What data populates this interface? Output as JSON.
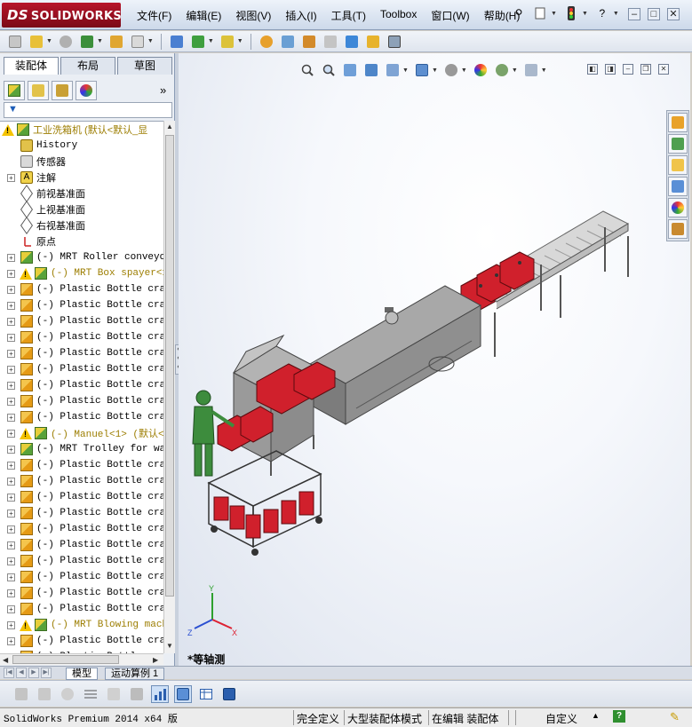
{
  "app": {
    "logo_text": "SOLIDWORKS",
    "logo_prefix": "DS"
  },
  "menu": [
    "文件(F)",
    "编辑(E)",
    "视图(V)",
    "插入(I)",
    "工具(T)",
    "Toolbox",
    "窗口(W)",
    "帮助(H)"
  ],
  "panel_tabs": [
    "装配体",
    "布局",
    "草图"
  ],
  "tree": {
    "root": "工业洗箱机  (默认<默认_显",
    "fixed": [
      "History",
      "传感器",
      "注解",
      "前视基准面",
      "上视基准面",
      "右视基准面",
      "原点"
    ],
    "components": [
      {
        "label": "(-) MRT Roller conveyor",
        "type": "asm",
        "warn": false
      },
      {
        "label": "(-) MRT Box spayer<1",
        "type": "asm",
        "warn": true
      },
      {
        "label": "(-) Plastic Bottle crat",
        "type": "part",
        "warn": false
      },
      {
        "label": "(-) Plastic Bottle crat",
        "type": "part",
        "warn": false
      },
      {
        "label": "(-) Plastic Bottle crat",
        "type": "part",
        "warn": false
      },
      {
        "label": "(-) Plastic Bottle crat",
        "type": "part",
        "warn": false
      },
      {
        "label": "(-) Plastic Bottle crat",
        "type": "part",
        "warn": false
      },
      {
        "label": "(-) Plastic Bottle crat",
        "type": "part",
        "warn": false
      },
      {
        "label": "(-) Plastic Bottle crat",
        "type": "part",
        "warn": false
      },
      {
        "label": "(-) Plastic Bottle crat",
        "type": "part",
        "warn": false
      },
      {
        "label": "(-) Plastic Bottle crat",
        "type": "part",
        "warn": false
      },
      {
        "label": "(-) Manuel<1> (默认<",
        "type": "asm",
        "warn": true
      },
      {
        "label": "(-) MRT Trolley for was",
        "type": "asm",
        "warn": false
      },
      {
        "label": "(-) Plastic Bottle crat",
        "type": "part",
        "warn": false
      },
      {
        "label": "(-) Plastic Bottle crat",
        "type": "part",
        "warn": false
      },
      {
        "label": "(-) Plastic Bottle crat",
        "type": "part",
        "warn": false
      },
      {
        "label": "(-) Plastic Bottle crat",
        "type": "part",
        "warn": false
      },
      {
        "label": "(-) Plastic Bottle crat",
        "type": "part",
        "warn": false
      },
      {
        "label": "(-) Plastic Bottle crat",
        "type": "part",
        "warn": false
      },
      {
        "label": "(-) Plastic Bottle crat",
        "type": "part",
        "warn": false
      },
      {
        "label": "(-) Plastic Bottle crat",
        "type": "part",
        "warn": false
      },
      {
        "label": "(-) Plastic Bottle crat",
        "type": "part",
        "warn": false
      },
      {
        "label": "(-) Plastic Bottle crat",
        "type": "part",
        "warn": false
      },
      {
        "label": "(-) MRT Blowing mach",
        "type": "asm",
        "warn": true
      },
      {
        "label": "(-) Plastic Bottle crat",
        "type": "part",
        "warn": false
      },
      {
        "label": "(-) Plastic Bottle crat",
        "type": "part",
        "warn": false
      }
    ]
  },
  "view": {
    "label": "*等轴测",
    "triad": {
      "x": "X",
      "y": "Y",
      "z": "Z"
    }
  },
  "bottom_tabs": [
    "模型",
    "运动算例 1"
  ],
  "status": {
    "product": "SolidWorks Premium 2014 x64 版",
    "definition": "完全定义",
    "mode": "大型装配体模式",
    "editing": "在编辑 装配体",
    "units": "自定义"
  },
  "colors": {
    "crate_red": "#d0202c",
    "machine_gray": "#8f8f8f",
    "warning_yellow": "#f5c400",
    "logo_red": "#b7152a"
  }
}
